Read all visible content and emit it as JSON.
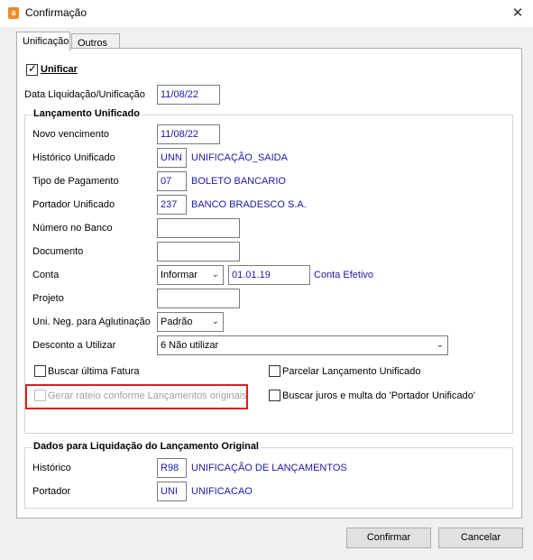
{
  "window": {
    "title": "Confirmação",
    "icon": "app-icon",
    "close_glyph": "✕"
  },
  "tabs": [
    {
      "label": "Unificação",
      "active": true
    },
    {
      "label": "Outros",
      "active": false
    }
  ],
  "unificar": {
    "label": "Unificar",
    "checked": true
  },
  "data_liquidacao": {
    "label": "Data Liquidação/Unificação",
    "value": "11/08/22"
  },
  "lancamento": {
    "title": "Lançamento Unificado",
    "novo_vencimento": {
      "label": "Novo vencimento",
      "value": "11/08/22"
    },
    "historico": {
      "label": "Histórico Unificado",
      "code": "UNN",
      "desc": "UNIFICAÇÃO_SAIDA"
    },
    "tipo_pagamento": {
      "label": "Tipo de Pagamento",
      "code": "07",
      "desc": "BOLETO BANCARIO"
    },
    "portador": {
      "label": "Portador Unificado",
      "code": "237",
      "desc": "BANCO BRADESCO S.A."
    },
    "numero_banco": {
      "label": "Número no Banco",
      "value": ""
    },
    "documento": {
      "label": "Documento",
      "value": ""
    },
    "conta": {
      "label": "Conta",
      "select": "Informar",
      "value": "01.01.19",
      "desc": "Conta Efetivo"
    },
    "projeto": {
      "label": "Projeto",
      "value": ""
    },
    "uni_neg": {
      "label": "Uni. Neg. para Aglutinação",
      "select": "Padrão"
    },
    "desconto": {
      "label": "Desconto a Utilizar",
      "select": "6 Não utilizar"
    },
    "buscar_fatura": {
      "label": "Buscar última Fatura",
      "checked": false
    },
    "gerar_rateio": {
      "label": "Gerar rateio conforme Lançamentos originais",
      "checked": false,
      "disabled": true
    },
    "parcelar": {
      "label": "Parcelar Lançamento Unificado",
      "checked": false
    },
    "buscar_juros": {
      "label": "Buscar juros e multa do 'Portador Unificado'",
      "checked": false
    }
  },
  "liquidacao": {
    "title": "Dados para Liquidação do Lançamento Original",
    "historico": {
      "label": "Histórico",
      "code": "R98",
      "desc": "UNIFICAÇÃO DE LANÇAMENTOS"
    },
    "portador": {
      "label": "Portador",
      "code": "UNI",
      "desc": "UNIFICACAO"
    }
  },
  "buttons": {
    "confirmar": "Confirmar",
    "cancelar": "Cancelar"
  },
  "colors": {
    "value_text": "#1a1aa8",
    "highlight": "#e01b1b"
  }
}
